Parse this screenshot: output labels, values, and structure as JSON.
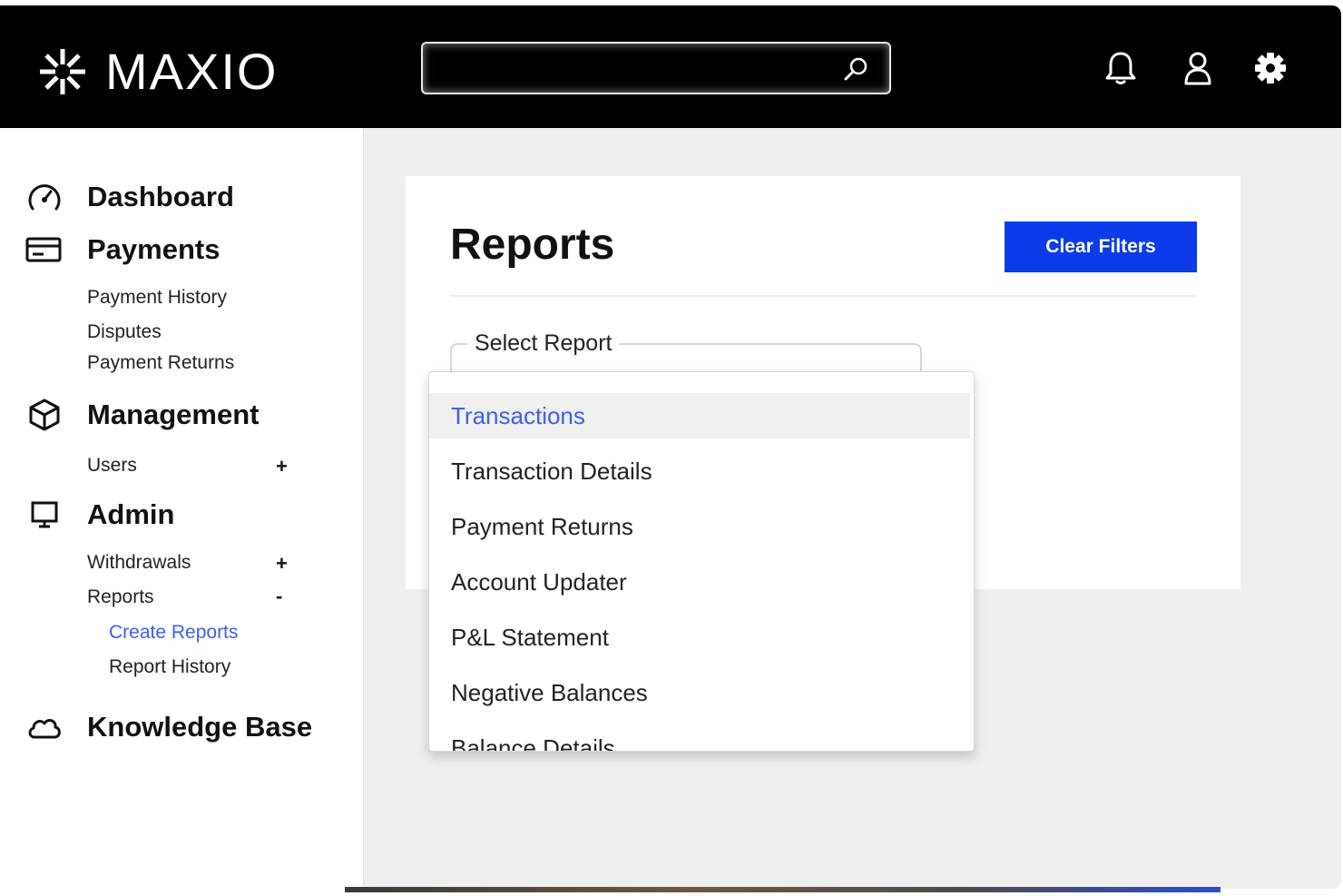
{
  "brand": {
    "name": "MAXIO"
  },
  "header": {
    "search": {
      "value": "",
      "placeholder": ""
    },
    "icons": [
      "search-icon",
      "bell-icon",
      "user-icon",
      "gear-icon"
    ]
  },
  "sidebar": {
    "dashboard": "Dashboard",
    "payments": {
      "label": "Payments",
      "items": [
        "Payment History",
        "Disputes",
        "Payment Returns"
      ]
    },
    "management": {
      "label": "Management",
      "users": {
        "label": "Users",
        "toggle": "+"
      }
    },
    "admin": {
      "label": "Admin",
      "withdrawals": {
        "label": "Withdrawals",
        "toggle": "+"
      },
      "reports": {
        "label": "Reports",
        "toggle": "-",
        "items": [
          "Create Reports",
          "Report History"
        ],
        "active": "Create Reports"
      }
    },
    "knowledge_base": "Knowledge Base"
  },
  "main": {
    "title": "Reports",
    "clear_filters": "Clear Filters",
    "select_report": {
      "label": "Select Report",
      "options": [
        "Transactions",
        "Transaction Details",
        "Payment Returns",
        "Account Updater",
        "P&L Statement",
        "Negative Balances",
        "Balance Details"
      ],
      "highlighted": "Transactions"
    }
  },
  "colors": {
    "header_bg": "#000000",
    "accent": "#0b3bea",
    "link_active": "#3d5ef0",
    "page_bg": "#efefef"
  }
}
